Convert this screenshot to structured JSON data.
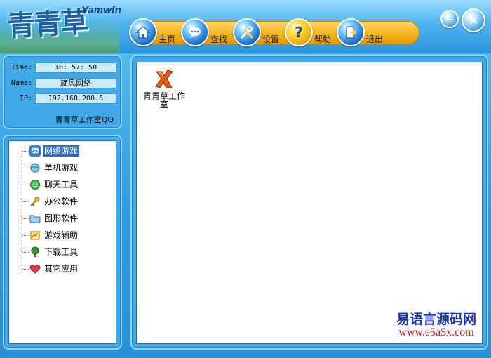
{
  "header": {
    "logo_text": "青青草",
    "logo_sub": "Yamwfn",
    "nav": [
      {
        "label": "主页",
        "icon": "home-icon"
      },
      {
        "label": "查找",
        "icon": "search-icon"
      },
      {
        "label": "设置",
        "icon": "tools-icon"
      },
      {
        "label": "帮助",
        "icon": "help-icon"
      },
      {
        "label": "退出",
        "icon": "exit-icon"
      }
    ],
    "window_controls": {
      "minimize": "−",
      "close": "✕"
    }
  },
  "info": {
    "time_label": "Time:",
    "time_value": "18: 57: 50",
    "name_label": "Name:",
    "name_value": "旋风网络",
    "ip_label": "IP:",
    "ip_value": "192.168.200.6",
    "studio_qq": "青青草工作室QQ"
  },
  "tree": {
    "items": [
      {
        "label": "网络游戏",
        "icon": "network-game-icon",
        "selected": true
      },
      {
        "label": "单机游戏",
        "icon": "single-game-icon",
        "selected": false
      },
      {
        "label": "聊天工具",
        "icon": "chat-icon",
        "selected": false
      },
      {
        "label": "办公软件",
        "icon": "office-key-icon",
        "selected": false
      },
      {
        "label": "图形软件",
        "icon": "folder-icon",
        "selected": false
      },
      {
        "label": "游戏辅助",
        "icon": "game-helper-icon",
        "selected": false
      },
      {
        "label": "下载工具",
        "icon": "tree-icon",
        "selected": false
      },
      {
        "label": "其它应用",
        "icon": "heart-icon",
        "selected": false
      }
    ]
  },
  "main": {
    "apps": [
      {
        "label": "青青草工作室",
        "icon": "studio-x-icon"
      }
    ]
  },
  "watermark": {
    "title": "易语言源码网",
    "url": "www.e5a5x.com"
  },
  "colors": {
    "accent": "#2e9ce0",
    "selection": "#316ac5",
    "nav_bar": "#f4b21a"
  }
}
